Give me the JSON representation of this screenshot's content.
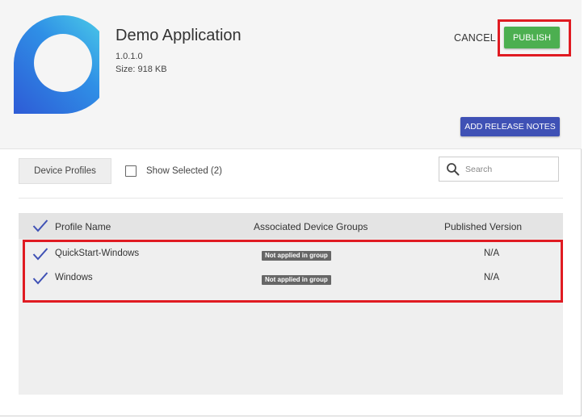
{
  "app": {
    "name": "Demo Application",
    "version": "1.0.1.0",
    "size": "Size: 918 KB"
  },
  "actions": {
    "cancel_label": "CANCEL",
    "publish_label": "PUBLISH",
    "release_notes_label": "ADD RELEASE NOTES"
  },
  "toolbar": {
    "tab_label": "Device Profiles",
    "show_selected_label": "Show Selected (2)",
    "show_selected_checked": false,
    "search_placeholder": "Search"
  },
  "table": {
    "columns": [
      "Profile Name",
      "Associated Device Groups",
      "Published Version"
    ],
    "rows": [
      {
        "name": "QuickStart-Windows",
        "group_badge": "Not applied in group",
        "version": "N/A",
        "selected": true
      },
      {
        "name": "Windows",
        "group_badge": "Not applied in group",
        "version": "N/A",
        "selected": true
      }
    ]
  },
  "colors": {
    "publish": "#4caf50",
    "release_notes": "#3f51b5",
    "check": "#3f51b5",
    "highlight": "#e01b22",
    "badge": "#666666"
  },
  "icons": {
    "logo": "app-logo-icon",
    "search": "search-icon",
    "check": "check-icon"
  }
}
